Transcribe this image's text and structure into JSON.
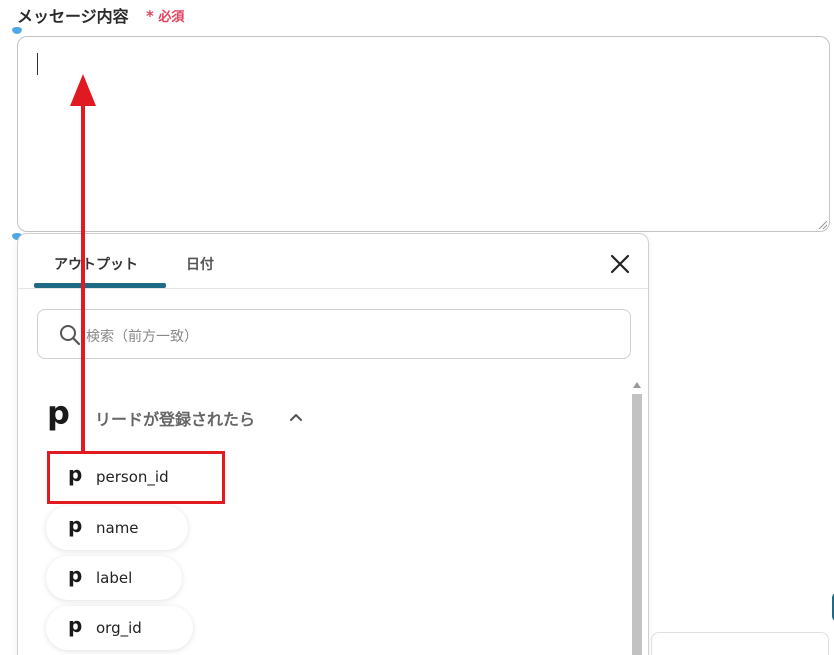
{
  "form": {
    "message_label": "メッセージ内容",
    "required_star": "*",
    "required_text": "必須",
    "message_value": ""
  },
  "popup": {
    "tabs": [
      {
        "label": "アウトプット",
        "active": true
      },
      {
        "label": "日付",
        "active": false
      }
    ],
    "close_icon": "close-icon",
    "search": {
      "placeholder": "検索（前方一致）",
      "icon": "search-icon"
    },
    "group": {
      "logo": "p",
      "title": "リードが登録されたら",
      "expanded": true,
      "items": [
        {
          "logo": "p",
          "label": "person_id",
          "highlighted": true
        },
        {
          "logo": "p",
          "label": "name",
          "highlighted": false
        },
        {
          "logo": "p",
          "label": "label",
          "highlighted": false
        },
        {
          "logo": "p",
          "label": "org_id",
          "highlighted": false
        }
      ]
    }
  },
  "colors": {
    "accent": "#1f6a84",
    "required": "#e0445e",
    "annotation": "#e11a22"
  }
}
